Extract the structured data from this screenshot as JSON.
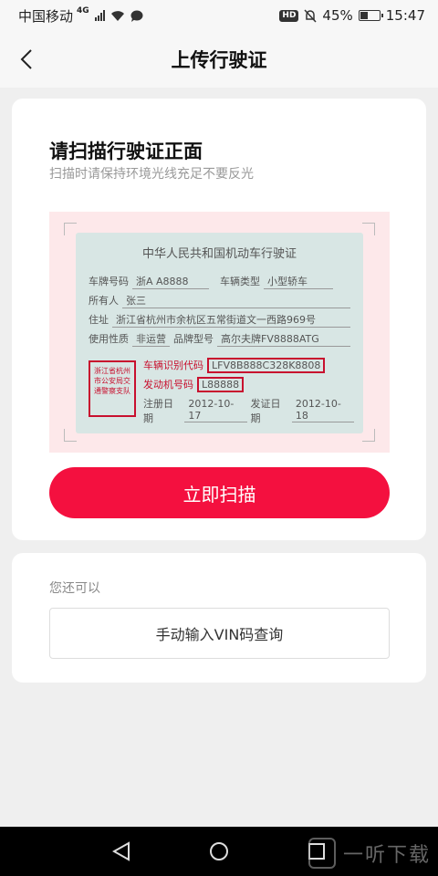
{
  "status_bar": {
    "carrier": "中国移动",
    "network": "4G",
    "hd": "HD",
    "battery_percent": "45%",
    "battery_level": 0.45,
    "time": "15:47"
  },
  "header": {
    "title": "上传行驶证"
  },
  "scan_card": {
    "title": "请扫描行驶证正面",
    "subtitle": "扫描时请保持环境光线充足不要反光",
    "button_label": "立即扫描",
    "license": {
      "title": "中华人民共和国机动车行驶证",
      "plate_label": "车牌号码",
      "plate_value": "浙A A8888",
      "type_label": "车辆类型",
      "type_value": "小型轿车",
      "owner_label": "所有人",
      "owner_value": "张三",
      "address_label": "住址",
      "address_value": "浙江省杭州市余杭区五常街道文一西路969号",
      "usage_label": "使用性质",
      "usage_value": "非运营",
      "model_label": "品牌型号",
      "model_value": "高尔夫牌FV8888ATG",
      "vin_label": "车辆识别代码",
      "vin_value": "LFV8B888C328K8808",
      "engine_label": "发动机号码",
      "engine_value": "L88888",
      "reg_date_label": "注册日期",
      "reg_date_value": "2012-10-17",
      "issue_date_label": "发证日期",
      "issue_date_value": "2012-10-18",
      "stamp_text": "浙江省杭州市公安局交通警察支队"
    }
  },
  "alt_card": {
    "label": "您还可以",
    "vin_button_label": "手动输入VIN码查询"
  },
  "watermark": {
    "text": "一听下载"
  }
}
